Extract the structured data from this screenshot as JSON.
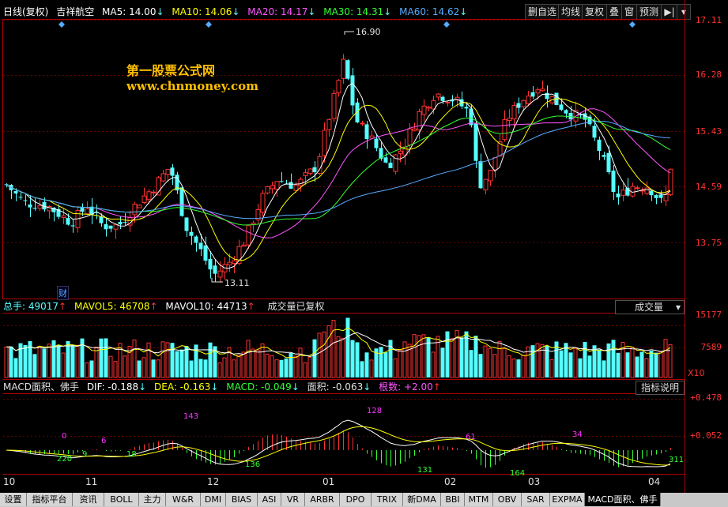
{
  "header": {
    "chart_mode": "日线(复权)",
    "stock_name": "吉祥航空",
    "ma5": "MA5: 14.00",
    "ma10": "MA10: 14.06",
    "ma20": "MA20: 14.17",
    "ma30": "MA30: 14.31",
    "ma60": "MA60: 14.62"
  },
  "toolbar": [
    "删自选",
    "均线",
    "复权",
    "叠",
    "窗",
    "预测"
  ],
  "watermark": {
    "line1": "第一股票公式网",
    "line2": "www.chnmoney.com"
  },
  "price_axis": [
    "17.11",
    "16.28",
    "15.43",
    "14.59",
    "13.75"
  ],
  "price_marks": {
    "high": "16.90",
    "low": "13.11",
    "event": "财"
  },
  "volume_header": {
    "total": "总手: 49017",
    "mavol5": "MAVOL5: 46708",
    "mavol10": "MAVOL10: 44713",
    "note": "成交量已复权",
    "selector": "成交量"
  },
  "volume_axis": {
    "top": "15177",
    "mid": "7589",
    "unit": "X10"
  },
  "macd_header": {
    "name": "MACD面积、佛手",
    "dif": "DIF: -0.188",
    "dea": "DEA: -0.163",
    "macd": "MACD: -0.049",
    "area": "面积: -0.063",
    "count": "根数: +2.00",
    "help": "指标说明"
  },
  "macd_axis": {
    "top": "+0.478",
    "mid": "+0.052"
  },
  "macd_labels": [
    {
      "t": "220",
      "c": "#3f3"
    },
    {
      "t": "0",
      "c": "#f3f"
    },
    {
      "t": "9",
      "c": "#3f3"
    },
    {
      "t": "6",
      "c": "#f3f"
    },
    {
      "t": "18",
      "c": "#3f3"
    },
    {
      "t": "143",
      "c": "#f3f"
    },
    {
      "t": "136",
      "c": "#3f3"
    },
    {
      "t": "128",
      "c": "#f3f"
    },
    {
      "t": "131",
      "c": "#3f3"
    },
    {
      "t": "61",
      "c": "#f3f"
    },
    {
      "t": "164",
      "c": "#3f3"
    },
    {
      "t": "34",
      "c": "#f3f"
    },
    {
      "t": "311",
      "c": "#3f3"
    }
  ],
  "time_axis": [
    "10",
    "11",
    "12",
    "01",
    "02",
    "03",
    "04"
  ],
  "tabs": [
    "设置",
    "指标平台",
    "资讯",
    "BOLL",
    "主力",
    "W&R",
    "DMI",
    "BIAS",
    "ASI",
    "VR",
    "ARBR",
    "DPO",
    "TRIX",
    "新DMA",
    "BBI",
    "MTM",
    "OBV",
    "SAR",
    "EXPMA",
    "MACD面积、佛手"
  ],
  "colors": {
    "up": "#ff3232",
    "down": "#55ffff",
    "ma5": "#ffffff",
    "ma10": "#ffff00",
    "ma20": "#ff55ff",
    "ma30": "#33ff33",
    "ma60": "#55aaff",
    "frame": "#b00000"
  }
}
